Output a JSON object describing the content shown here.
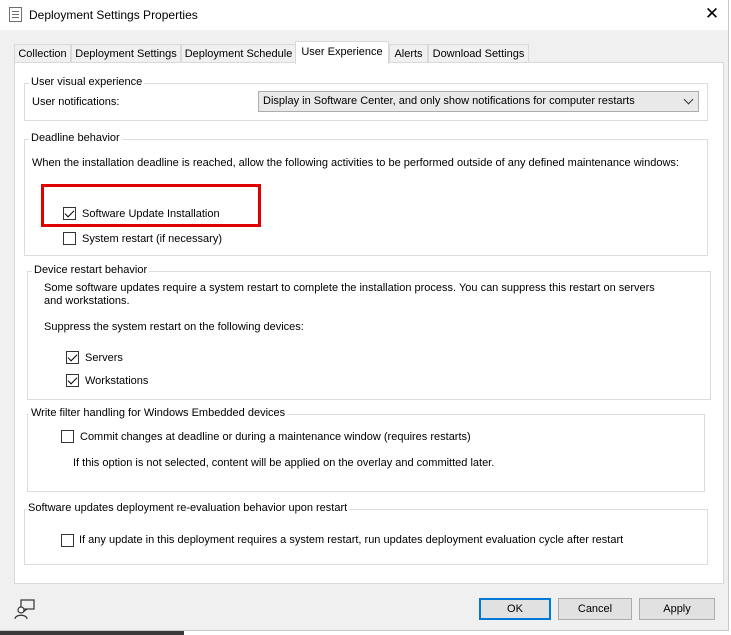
{
  "window": {
    "title": "Deployment Settings Properties",
    "close_glyph": "✕"
  },
  "tabs": [
    {
      "label": "Collection",
      "active": false
    },
    {
      "label": "Deployment Settings",
      "active": false
    },
    {
      "label": "Deployment Schedule",
      "active": false
    },
    {
      "label": "User Experience",
      "active": true
    },
    {
      "label": "Alerts",
      "active": false
    },
    {
      "label": "Download Settings",
      "active": false
    }
  ],
  "user_visual": {
    "group_title": "User visual experience",
    "notifications_label": "User notifications:",
    "notifications_value": "Display in Software Center, and only show notifications for computer restarts"
  },
  "deadline": {
    "group_title": "Deadline behavior",
    "description": "When the installation deadline is reached, allow the following activities to be performed outside of any defined maintenance windows:",
    "software_update_installation": {
      "label": "Software Update Installation",
      "checked": true
    },
    "system_restart": {
      "label": "System restart (if necessary)",
      "checked": false
    }
  },
  "device_restart": {
    "group_title": "Device restart behavior",
    "description": "Some software updates require a system restart to complete the installation process. You can suppress this restart on servers and workstations.",
    "suppress_label": "Suppress the system restart on the following devices:",
    "servers": {
      "label": "Servers",
      "checked": true
    },
    "workstations": {
      "label": "Workstations",
      "checked": true
    }
  },
  "write_filter": {
    "group_title": "Write filter handling for Windows Embedded devices",
    "commit": {
      "label": "Commit changes at deadline or during a maintenance window (requires restarts)",
      "checked": false
    },
    "note": "If this option is not selected, content will be applied on the overlay and committed later."
  },
  "reevaluation": {
    "group_title": "Software updates deployment re-evaluation behavior upon restart",
    "option": {
      "label": "If any update in this deployment requires a system restart, run updates deployment evaluation cycle after restart",
      "checked": false
    }
  },
  "buttons": {
    "ok": "OK",
    "cancel": "Cancel",
    "apply": "Apply"
  },
  "icons": {
    "title": "document-icon",
    "feedback": "feedback-person-icon"
  },
  "colors": {
    "highlight": "#e00000",
    "focus_border": "#0078d7"
  }
}
